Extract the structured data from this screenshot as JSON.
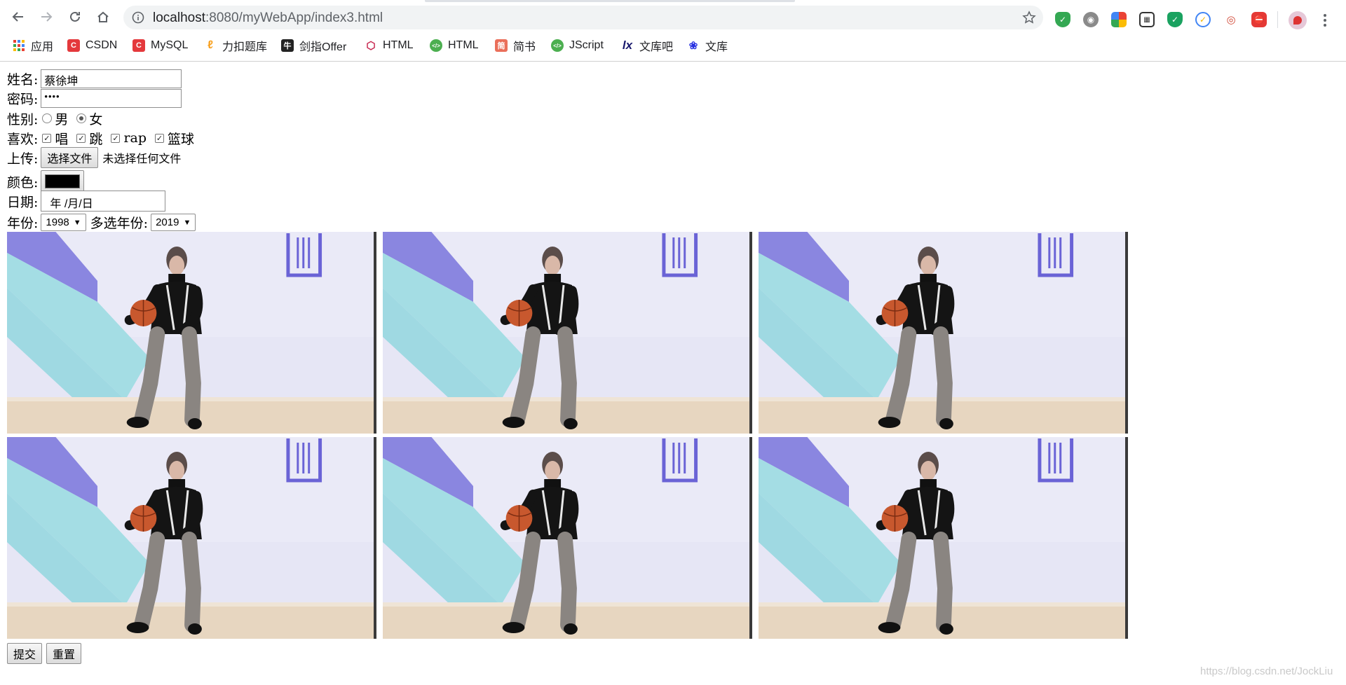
{
  "browser": {
    "url_host": "localhost",
    "url_path": ":8080/myWebApp/index3.html",
    "bookmarks": [
      {
        "label": "应用",
        "icon": "apps-grid-icon",
        "color": "#4285f4"
      },
      {
        "label": "CSDN",
        "icon": "csdn-icon",
        "color": "#e4393c"
      },
      {
        "label": "MySQL",
        "icon": "csdn-icon",
        "color": "#e4393c"
      },
      {
        "label": "力扣题库",
        "icon": "leetcode-icon",
        "color": "#f89f1b"
      },
      {
        "label": "剑指Offer",
        "icon": "nowcoder-icon",
        "color": "#222222"
      },
      {
        "label": "HTML",
        "icon": "html5-icon",
        "color": "#c7254e"
      },
      {
        "label": "HTML",
        "icon": "code-icon",
        "color": "#4caf50"
      },
      {
        "label": "简书",
        "icon": "jianshu-icon",
        "color": "#ea6f5a"
      },
      {
        "label": "JScript",
        "icon": "code-icon",
        "color": "#4caf50"
      },
      {
        "label": "文库吧",
        "icon": "wenkuba-icon",
        "color": "#1a1a6e"
      },
      {
        "label": "文库",
        "icon": "baidu-paw-icon",
        "color": "#2932e1"
      }
    ],
    "extensions": [
      {
        "icon": "shield-check-icon",
        "color": "#34a853"
      },
      {
        "icon": "owl-icon",
        "color": "#777777"
      },
      {
        "icon": "color-grid-icon",
        "color": "#ea4335"
      },
      {
        "icon": "qr-code-icon",
        "color": "#333333"
      },
      {
        "icon": "shield-icon",
        "color": "#1aa260"
      },
      {
        "icon": "check-circle-icon",
        "color": "#4285f4"
      },
      {
        "icon": "mask-icon",
        "color": "#d14836"
      },
      {
        "icon": "adblock-icon",
        "color": "#e53935"
      }
    ]
  },
  "form": {
    "name_label": "姓名:",
    "name_value": "蔡徐坤",
    "password_label": "密码:",
    "password_value": "••••",
    "gender_label": "性别:",
    "gender_options": [
      "男",
      "女"
    ],
    "gender_selected": "女",
    "hobby_label": "喜欢:",
    "hobbies": [
      "唱",
      "跳",
      "rap",
      "篮球"
    ],
    "upload_label": "上传:",
    "upload_button": "选择文件",
    "upload_status": "未选择任何文件",
    "color_label": "颜色:",
    "color_value": "#000000",
    "date_label": "日期:",
    "date_placeholder": "年 /月/日",
    "year_label": "年份:",
    "year_value": "1998",
    "multi_year_label": "多选年份:",
    "multi_year_value": "2019",
    "submit_button": "提交",
    "reset_button": "重置"
  },
  "gallery": {
    "image_count": 6,
    "image_subject": "basketball-player-gif"
  },
  "watermark": "https://blog.csdn.net/JockLiu"
}
